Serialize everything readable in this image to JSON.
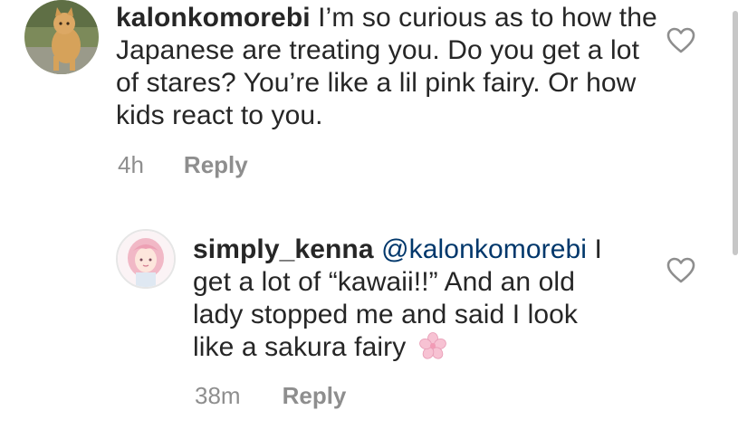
{
  "comments": [
    {
      "username": "kalonkomorebi",
      "text": "I’m so curious as to how the Japanese are treating you. Do you get a lot of stares? You’re like a lil pink fairy. Or how kids react to you.",
      "time": "4h",
      "reply_label": "Reply",
      "avatar_icon": "cat-photo-avatar"
    },
    {
      "username": "simply_kenna",
      "mention": "@kalonkomorebi",
      "text": "I get a lot of “kawaii!!” And an old lady stopped me and said I look like a sakura fairy",
      "emoji": "cherry-blossom-icon",
      "time": "38m",
      "reply_label": "Reply",
      "avatar_icon": "illustrated-girl-avatar"
    }
  ],
  "icons": {
    "like": "heart-outline-icon"
  },
  "colors": {
    "text": "#262626",
    "muted": "#8e8e8e",
    "mention": "#00376b",
    "blossom": "#f4a7c0"
  }
}
